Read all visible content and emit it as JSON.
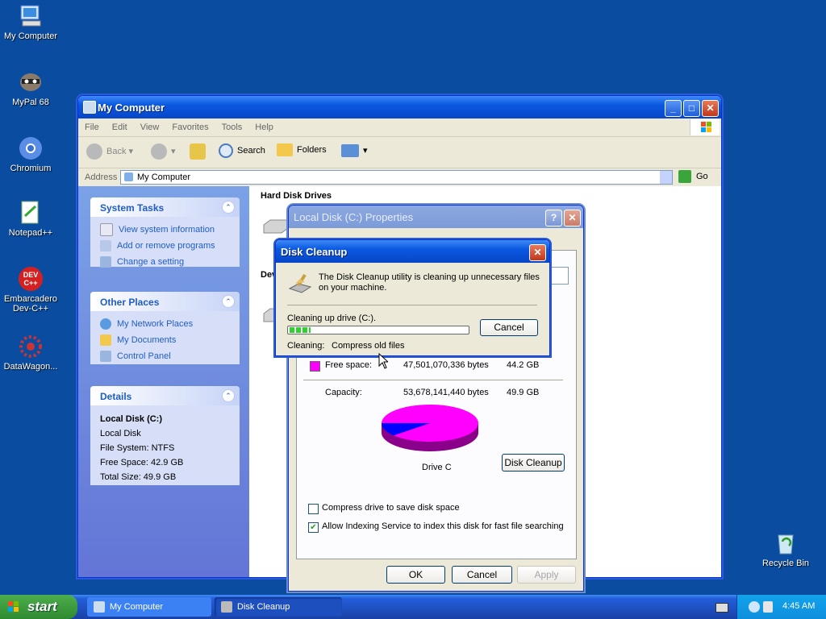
{
  "desktop": {
    "icons": [
      {
        "label": "My Computer"
      },
      {
        "label": "MyPal 68"
      },
      {
        "label": "Chromium"
      },
      {
        "label": "Notepad++"
      },
      {
        "label": "Embarcadero Dev-C++"
      },
      {
        "label": "DataWagon..."
      },
      {
        "label": "Recycle Bin"
      }
    ]
  },
  "explorer": {
    "title": "My Computer",
    "menu": [
      "File",
      "Edit",
      "View",
      "Favorites",
      "Tools",
      "Help"
    ],
    "toolbar": {
      "back": "Back",
      "search": "Search",
      "folders": "Folders"
    },
    "address": {
      "label": "Address",
      "value": "My Computer",
      "go": "Go"
    },
    "system_tasks": {
      "title": "System Tasks",
      "items": [
        "View system information",
        "Add or remove programs",
        "Change a setting"
      ]
    },
    "other_places": {
      "title": "Other Places",
      "items": [
        "My Network Places",
        "My Documents",
        "Control Panel"
      ]
    },
    "details": {
      "title": "Details",
      "name": "Local Disk (C:)",
      "type": "Local Disk",
      "fs": "File System: NTFS",
      "free": "Free Space: 42.9 GB",
      "total": "Total Size: 49.9 GB"
    },
    "sections": {
      "hard_disk": "Hard Disk Drives",
      "devices_partial": "Dev"
    }
  },
  "properties": {
    "title": "Local Disk (C:) Properties",
    "free_label": "Free space:",
    "free_bytes": "47,501,070,336 bytes",
    "free_gb": "44.2 GB",
    "capacity_label": "Capacity:",
    "capacity_bytes": "53,678,141,440 bytes",
    "capacity_gb": "49.9 GB",
    "drive_label": "Drive C",
    "disk_cleanup": "Disk Cleanup",
    "compress": "Compress drive to save disk space",
    "indexing": "Allow Indexing Service to index this disk for fast file searching",
    "ok": "OK",
    "cancel": "Cancel",
    "apply": "Apply",
    "used_fraction": 0.115
  },
  "disk_cleanup": {
    "title": "Disk Cleanup",
    "message": "The Disk Cleanup utility is cleaning up unnecessary files on your machine.",
    "drive_line": "Cleaning up drive  (C:).",
    "cancel": "Cancel",
    "cleaning_label": "Cleaning:",
    "cleaning_value": "Compress old files",
    "progress": 0.12
  },
  "taskbar": {
    "start": "start",
    "tasks": [
      "My Computer",
      "Disk Cleanup"
    ],
    "clock": "4:45 AM"
  },
  "colors": {
    "free": "#ff00ff",
    "used": "#0000ff"
  }
}
